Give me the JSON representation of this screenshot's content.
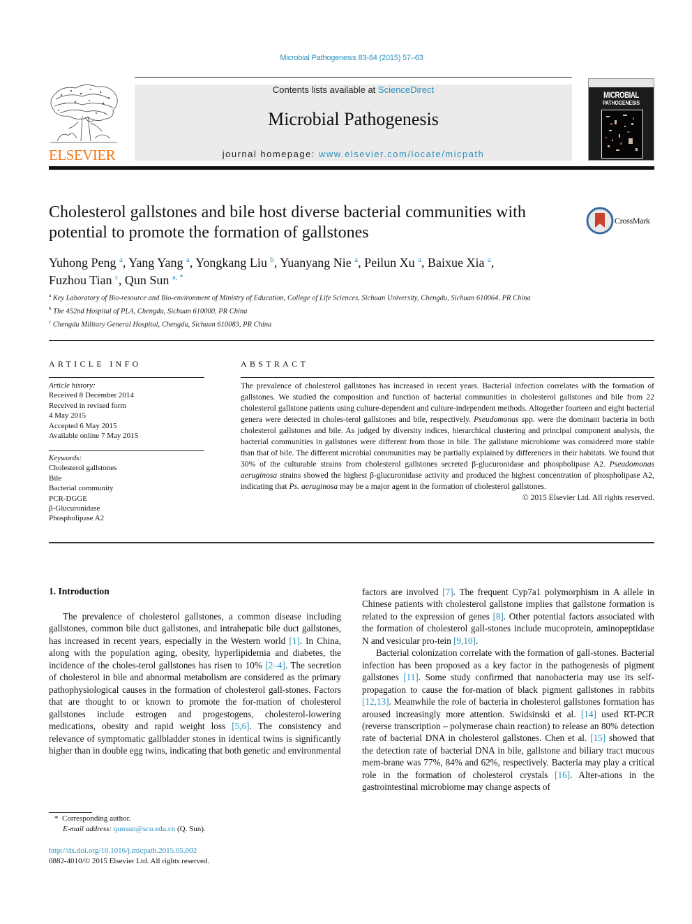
{
  "header": {
    "journal_ref": "Microbial Pathogenesis 83-84 (2015) 57–63",
    "contents_prefix": "Contents lists available at ",
    "contents_link": "ScienceDirect",
    "journal_title": "Microbial Pathogenesis",
    "homepage_prefix": "journal homepage: ",
    "homepage_link": "www.elsevier.com/locate/micpath",
    "publisher_logo_text": "ELSEVIER",
    "cover_title_1": "MICROBIAL",
    "cover_title_2": "PATHOGENESIS",
    "crossmark_label": "CrossMark",
    "brand_color": "#f07a1d",
    "link_color": "#2a8fbd"
  },
  "article": {
    "title": "Cholesterol gallstones and bile host diverse bacterial communities with potential to promote the formation of gallstones",
    "authors": [
      {
        "name": "Yuhong Peng",
        "aff": "a",
        "sep": ", "
      },
      {
        "name": "Yang Yang",
        "aff": "a",
        "sep": ", "
      },
      {
        "name": "Yongkang Liu",
        "aff": "b",
        "sep": ", "
      },
      {
        "name": "Yuanyang Nie",
        "aff": "a",
        "sep": ", "
      },
      {
        "name": "Peilun Xu",
        "aff": "a",
        "sep": ", "
      },
      {
        "name": "Baixue Xia",
        "aff": "a",
        "sep": ","
      },
      {
        "name": "Fuzhou Tian",
        "aff": "c",
        "sep": ", "
      },
      {
        "name": "Qun Sun",
        "aff": "a, *",
        "sep": ""
      }
    ],
    "affiliations": [
      {
        "key": "a",
        "text": "Key Laboratory of Bio-resource and Bio-environment of Ministry of Education, College of Life Sciences, Sichuan University, Chengdu, Sichuan 610064, PR China"
      },
      {
        "key": "b",
        "text": "The 452nd Hospital of PLA, Chengdu, Sichuan 610000, PR China"
      },
      {
        "key": "c",
        "text": "Chengdu Military General Hospital, Chengdu, Sichuan 610083, PR China"
      }
    ]
  },
  "article_info": {
    "heading": "ARTICLE INFO",
    "history_label": "Article history:",
    "history": [
      "Received 8 December 2014",
      "Received in revised form",
      "4 May 2015",
      "Accepted 6 May 2015",
      "Available online 7 May 2015"
    ],
    "keywords_label": "Keywords:",
    "keywords": [
      "Cholesterol gallstones",
      "Bile",
      "Bacterial community",
      "PCR-DGGE",
      "β-Glucuronidase",
      "Phospholipase A2"
    ]
  },
  "abstract": {
    "heading": "ABSTRACT",
    "parts": [
      "The prevalence of cholesterol gallstones has increased in recent years. Bacterial infection correlates with the formation of gallstones. We studied the composition and function of bacterial communities in cholesterol gallstones and bile from 22 cholesterol gallstone patients using culture-dependent and culture-independent methods. Altogether fourteen and eight bacterial genera were detected in choles-terol gallstones and bile, respectively. ",
      "Pseudomonas",
      " spp. were the dominant bacteria in both cholesterol gallstones and bile. As judged by diversity indices, hierarchical clustering and principal component analysis, the bacterial communities in gallstones were different from those in bile. The gallstone microbiome was considered more stable than that of bile. The different microbial communities may be partially explained by differences in their habitats. We found that 30% of the culturable strains from cholesterol gallstones secreted β-glucuronidase and phospholipase A2. ",
      "Pseudomonas aeruginosa",
      " strains showed the highest β-glucuronidase activity and produced the highest concentration of phospholipase A2, indicating that ",
      "Ps. aeruginosa",
      " may be a major agent in the formation of cholesterol gallstones."
    ],
    "copyright": "© 2015 Elsevier Ltd. All rights reserved."
  },
  "body": {
    "section_heading": "1.  Introduction",
    "left": [
      [
        "The prevalence of cholesterol gallstones, a common disease including gallstones, common bile duct gallstones, and intrahepatic bile duct gallstones, has increased in recent years, especially in the Western world ",
        "[1]",
        ". In China, along with the population aging, obesity, hyperlipidemia and diabetes, the incidence of the choles-terol gallstones has risen to 10% ",
        "[2–4]",
        ". The secretion of cholesterol in bile and abnormal metabolism are considered as the primary pathophysiological causes in the formation of cholesterol gall-stones. Factors that are thought to or known to promote the for-mation of cholesterol gallstones include estrogen and progestogens, cholesterol-lowering medications, obesity and rapid weight loss ",
        "[5,6]",
        ". The consistency and relevance of symptomatic gallbladder stones in identical twins is significantly higher than in double egg twins, indicating that both genetic and environmental"
      ]
    ],
    "right": [
      [
        "factors are involved ",
        "[7]",
        ". The frequent Cyp7a1 polymorphism in A allele in Chinese patients with cholesterol gallstone implies that gallstone formation is related to the expression of genes ",
        "[8]",
        ". Other potential factors associated with the formation of cholesterol gall-stones include mucoprotein, aminopeptidase N and vesicular pro-tein ",
        "[9,10]",
        "."
      ],
      [
        "Bacterial colonization correlate with the formation of gall-stones. Bacterial infection has been proposed as a key factor in the pathogenesis of pigment gallstones ",
        "[11]",
        ". Some study confirmed that nanobacteria may use its self-propagation to cause the for-mation of black pigment gallstones in rabbits ",
        "[12,13]",
        ". Meanwhile the role of bacteria in cholesterol gallstones formation has aroused increasingly more attention. Swidsinski et al. ",
        "[14]",
        " used RT-PCR (reverse transcription – polymerase chain reaction) to release an 80% detection rate of bacterial DNA in cholesterol gallstones. Chen et al. ",
        "[15]",
        " showed that the detection rate of bacterial DNA in bile, gallstone and biliary tract mucous mem-brane was 77%, 84% and 62%, respectively. Bacteria may play a critical role in the formation of cholesterol crystals ",
        "[16]",
        ". Alter-ations in the gastrointestinal microbiome may change aspects of"
      ]
    ]
  },
  "footnote": {
    "star": "*",
    "corresponding": "Corresponding author.",
    "email_label": "E-mail address: ",
    "email": "qunsun@scu.edu.cn",
    "email_suffix": " (Q. Sun).",
    "doi": "http://dx.doi.org/10.1016/j.micpath.2015.05.002",
    "issn_copyright": "0882-4010/© 2015 Elsevier Ltd. All rights reserved."
  }
}
